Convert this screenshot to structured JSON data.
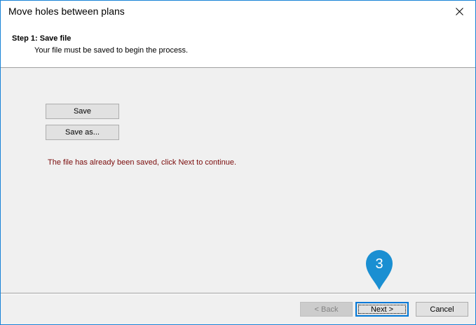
{
  "window": {
    "title": "Move holes between plans",
    "accent_color": "#1883d7"
  },
  "header": {
    "step_title": "Step 1: Save file",
    "step_description": "Your file must be saved to begin the process."
  },
  "actions": {
    "save_label": "Save",
    "save_as_label": "Save as..."
  },
  "status": {
    "message": "The file has already been saved, click Next to continue.",
    "color": "#7a0b0b"
  },
  "footer": {
    "back_label": "< Back",
    "next_label": "Next >",
    "cancel_label": "Cancel"
  },
  "annotation": {
    "marker_number": "3",
    "marker_color": "#1a8fd2"
  }
}
